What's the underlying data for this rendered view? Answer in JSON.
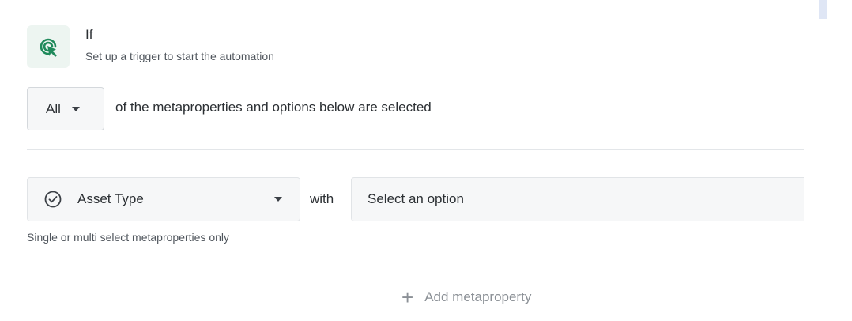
{
  "trigger": {
    "icon": "cursor-click-icon",
    "title": "If",
    "subtitle": "Set up a trigger to start the automation",
    "accent_color": "#1f8a5b"
  },
  "match": {
    "selected": "All",
    "text": "of the metaproperties and options below are selected"
  },
  "condition": {
    "property_icon": "check-circle-icon",
    "property": "Asset Type",
    "connector": "with",
    "option_placeholder": "Select an option",
    "hint": "Single or multi select metaproperties only"
  },
  "actions": {
    "add_label": "Add metaproperty",
    "add_icon": "plus-icon"
  }
}
